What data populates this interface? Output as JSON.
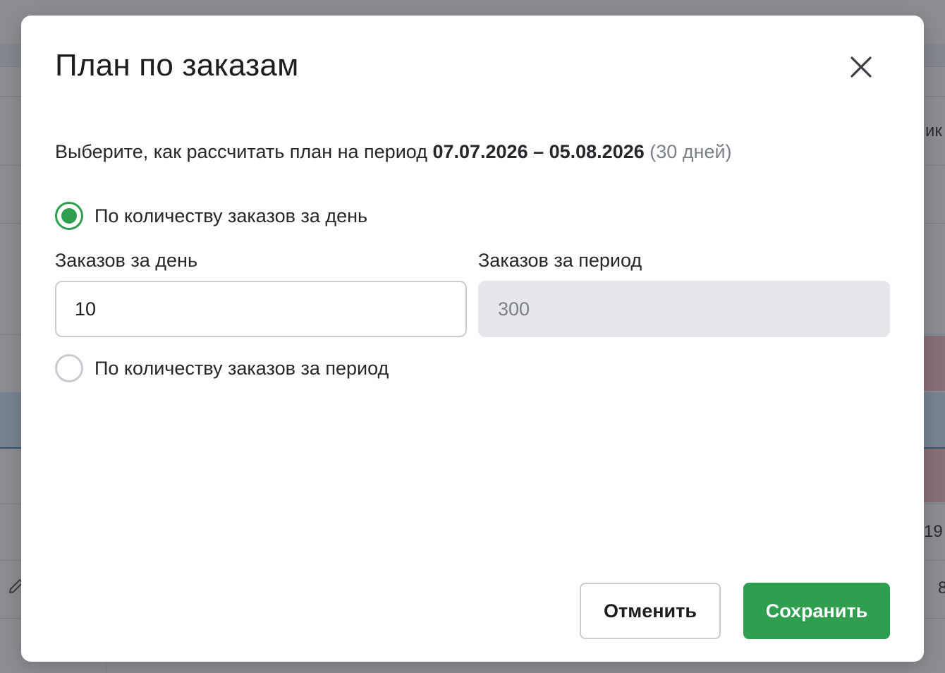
{
  "modal": {
    "title": "План по заказам",
    "description": {
      "prefix": "Выберите, как рассчитать план на период ",
      "period": "07.07.2026 – 05.08.2026",
      "days": " (30 дней)"
    },
    "options": [
      {
        "label": "По количеству заказов за день",
        "selected": true
      },
      {
        "label": "По количеству заказов за период",
        "selected": false
      }
    ],
    "fields": {
      "per_day": {
        "label": "Заказов за день",
        "value": "10"
      },
      "per_period": {
        "label": "Заказов за период",
        "value": "300"
      }
    },
    "buttons": {
      "cancel": "Отменить",
      "save": "Сохранить"
    }
  },
  "background": {
    "partial_texts": [
      "ик",
      "19",
      "8"
    ]
  },
  "colors": {
    "accent_green": "#2f9e4f",
    "readonly_fill": "#e6e7ea",
    "overlay": "#8a8f97"
  },
  "icons": {
    "close": "close-icon",
    "edit": "pencil-icon"
  }
}
